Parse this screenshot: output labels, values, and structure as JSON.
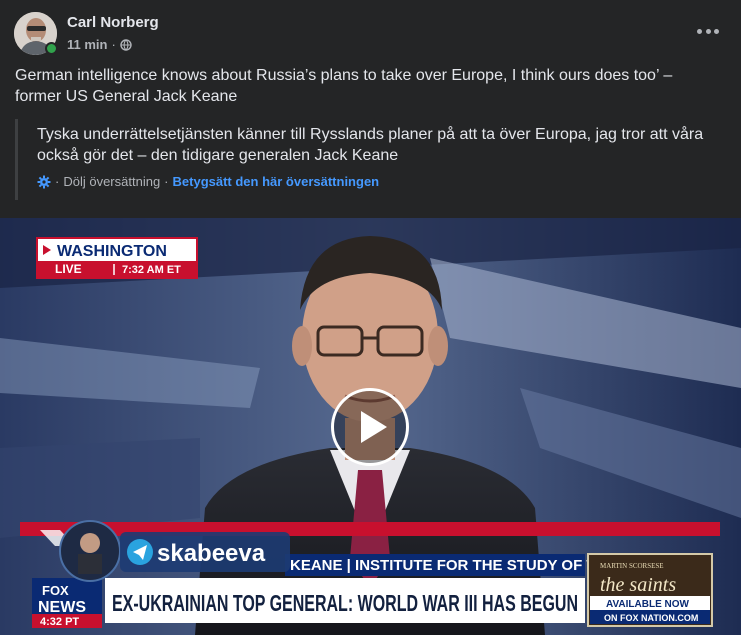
{
  "post": {
    "author": "Carl Norberg",
    "time": "11 min",
    "separator": "·",
    "text": "German intelligence knows about Russia’s plans to take over Europe, I think ours does too’ – former US General Jack Keane"
  },
  "translation": {
    "text": "Tyska underrättelsetjänsten känner till Rysslands planer på att ta över Europa, jag tror att våra också gör det – den tidigare generalen Jack Keane",
    "hide_label": "Dölj översättning",
    "rate_label": "Betygsätt den här översättningen",
    "separator": "·"
  },
  "video": {
    "location": "WASHINGTON",
    "live_label": "LIVE",
    "live_time": "7:32 AM ET",
    "channel": "skabeeva",
    "lower_third_top": "KEANE | INSTITUTE FOR THE STUDY OF WAR",
    "headline": "EX-UKRAINIAN TOP GENERAL: WORLD WAR III HAS BEGUN",
    "fox": "FOX",
    "news": "NEWS",
    "bug_time": "4:32 PT",
    "promo_small": "MARTIN SCORSESE",
    "promo_title": "the saints",
    "promo_avail": "AVAILABLE NOW",
    "promo_on": "ON FOX NATION.COM"
  },
  "icons": {
    "more": "more-options-icon",
    "privacy": "globe-icon",
    "translate": "translate-gear-icon",
    "play": "play-icon"
  },
  "colors": {
    "background": "#242526",
    "text": "#e4e6eb",
    "secondary": "#b0b3b8",
    "link": "#4599ff",
    "online": "#31a24c",
    "fox_red": "#c8102e",
    "fox_blue": "#0a2a73"
  }
}
